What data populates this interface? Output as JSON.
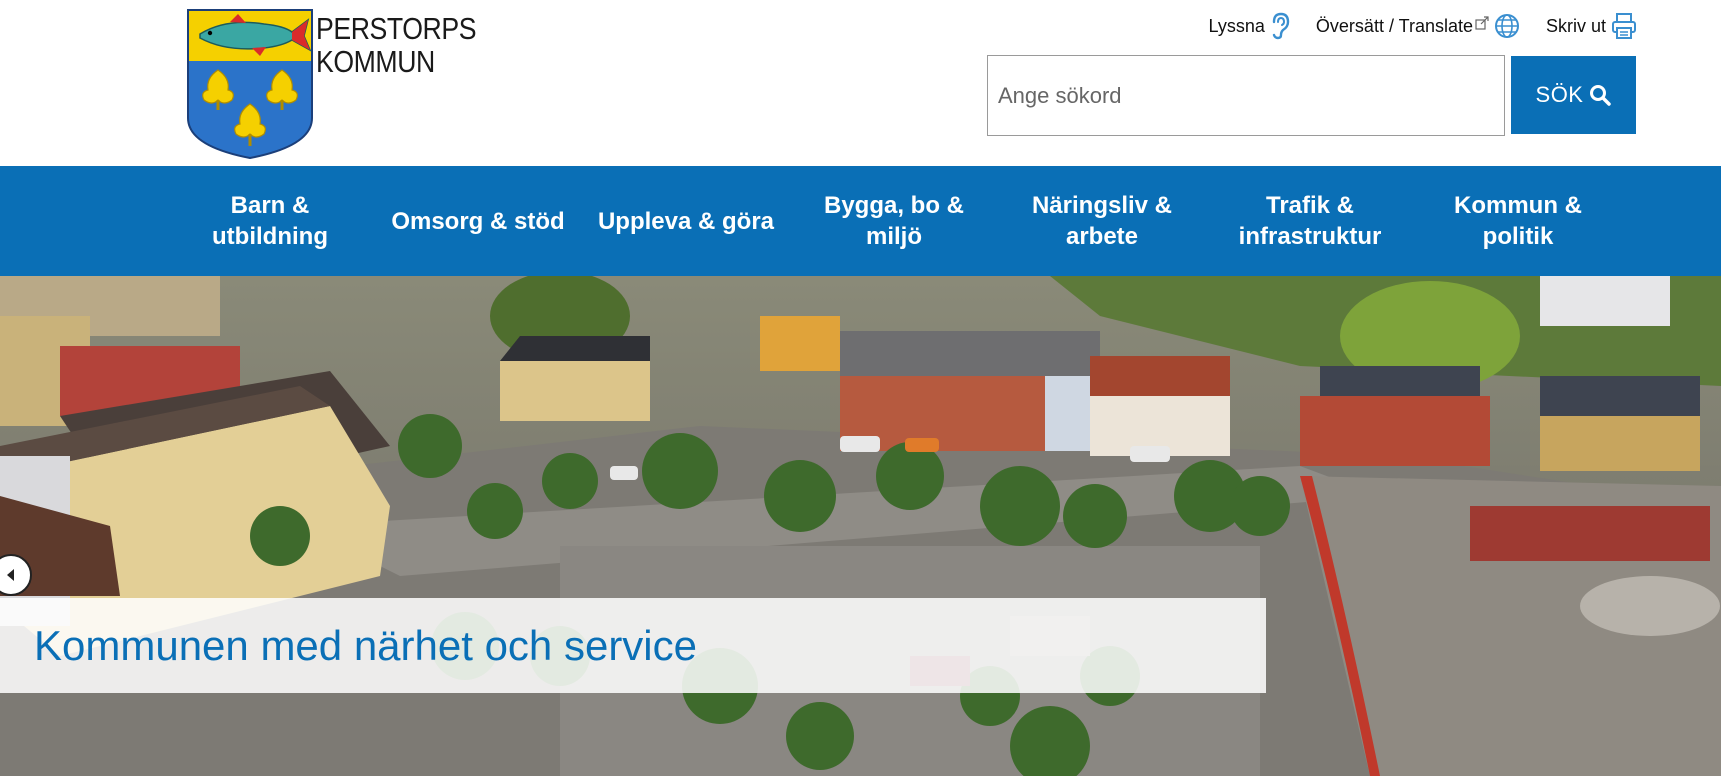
{
  "header": {
    "logo": {
      "line1": "PERSTORPS",
      "line2": "KOMMUN"
    },
    "tools": {
      "listen_label": "Lyssna",
      "translate_label": "Översätt / Translate",
      "print_label": "Skriv ut"
    },
    "search": {
      "placeholder": "Ange sökord",
      "value": "",
      "button_label": "SÖK"
    }
  },
  "nav": {
    "items": [
      {
        "label": "Barn & utbildning"
      },
      {
        "label": "Omsorg & stöd"
      },
      {
        "label": "Uppleva & göra"
      },
      {
        "label": "Bygga, bo & miljö"
      },
      {
        "label": "Näringsliv & arbete"
      },
      {
        "label": "Trafik & infrastruktur"
      },
      {
        "label": "Kommun & politik"
      }
    ]
  },
  "hero": {
    "caption": "Kommunen med närhet och service"
  },
  "colors": {
    "brand_blue": "#0a6fb6",
    "crest_yellow": "#f5d000",
    "crest_blue": "#2b73c9"
  }
}
